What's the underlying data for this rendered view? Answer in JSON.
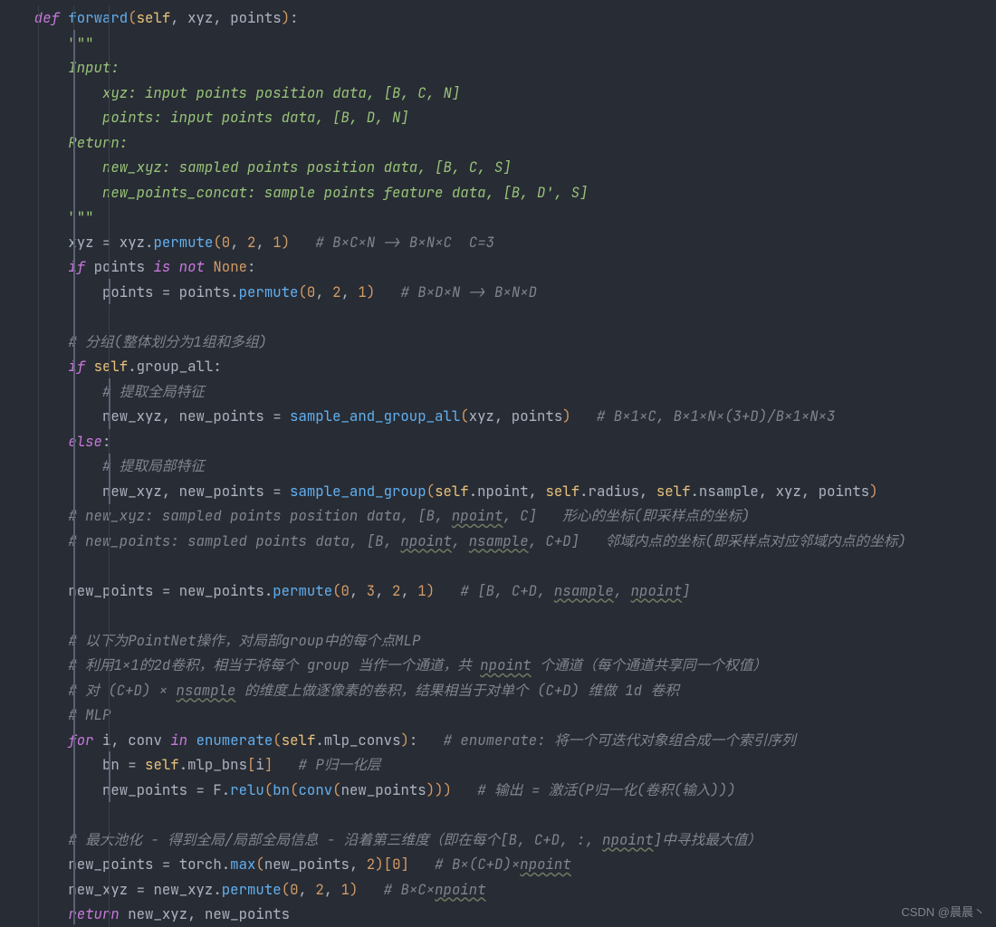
{
  "watermark": "CSDN @晨晨丶",
  "code": {
    "line01": {
      "kw_def": "def",
      "fn": "forward",
      "par_o": "(",
      "self": "self",
      "c1": ", ",
      "a1": "xyz",
      "c2": ", ",
      "a2": "points",
      "par_c": ")",
      "colon": ":"
    },
    "line02": {
      "tdq": "\"\"\""
    },
    "line03": {
      "txt": "Input:"
    },
    "line04": {
      "txt": "    xyz: input points position data, [B, C, N]"
    },
    "line05": {
      "txt": "    points: input points data, [B, D, N]"
    },
    "line06": {
      "txt": "Return:"
    },
    "line07": {
      "txt": "    new_xyz: sampled points position data, [B, C, S]"
    },
    "line08": {
      "txt": "    new_points_concat: sample points feature data, [B, D', S]"
    },
    "line09": {
      "tdq": "\"\"\""
    },
    "line10": {
      "lhs": "xyz ",
      "eq": "= ",
      "rhs_id": "xyz",
      "dot": ".",
      "fn": "permute",
      "po": "(",
      "n0": "0",
      "c1": ", ",
      "n1": "2",
      "c2": ", ",
      "n2": "1",
      "pc": ")",
      "cm": "   # B×C×N -> B×N×C  C=3"
    },
    "line11": {
      "kw_if": "if",
      "sp": " ",
      "id": "points",
      "sp2": " ",
      "kw_is": "is",
      "sp3": " ",
      "kw_not": "not",
      "sp4": " ",
      "none": "None",
      "colon": ":"
    },
    "line12": {
      "lhs": "points ",
      "eq": "= ",
      "rhs_id": "points",
      "dot": ".",
      "fn": "permute",
      "po": "(",
      "n0": "0",
      "c1": ", ",
      "n1": "2",
      "c2": ", ",
      "n2": "1",
      "pc": ")",
      "cm": "   # B×D×N -> B×N×D"
    },
    "line14": {
      "cm": "# 分组(整体划分为1组和多组)"
    },
    "line15": {
      "kw_if": "if",
      "sp": " ",
      "self": "self",
      "dot": ".",
      "attr": "group_all",
      "colon": ":"
    },
    "line16": {
      "cm": "# 提取全局特征"
    },
    "line17": {
      "lhs": "new_xyz, new_points ",
      "eq": "= ",
      "fn": "sample_and_group_all",
      "po": "(",
      "a1": "xyz",
      "c1": ", ",
      "a2": "points",
      "pc": ")",
      "cm": "   # B×1×C, B×1×N×(3+D)/B×1×N×3"
    },
    "line18": {
      "kw_else": "else",
      "colon": ":"
    },
    "line19": {
      "cm": "# 提取局部特征"
    },
    "line20": {
      "lhs": "new_xyz, new_points ",
      "eq": "= ",
      "fn": "sample_and_group",
      "po": "(",
      "self1": "self",
      "d1": ".",
      "a1": "npoint",
      "c1": ", ",
      "self2": "self",
      "d2": ".",
      "a2": "radius",
      "c2": ", ",
      "self3": "self",
      "d3": ".",
      "a3": "nsample",
      "c3": ", ",
      "a4": "xyz",
      "c4": ", ",
      "a5": "points",
      "pc": ")"
    },
    "line21": {
      "pre": "# new_xyz: sampled points position data, [B, ",
      "w": "npoint",
      "post": ", C]   形心的坐标(即采样点的坐标)"
    },
    "line22": {
      "pre": "# new_points: sampled points data, [B, ",
      "w1": "npoint",
      "mid": ", ",
      "w2": "nsample",
      "post": ", C+D]   邻域内点的坐标(即采样点对应邻域内点的坐标)"
    },
    "line24": {
      "lhs": "new_points ",
      "eq": "= ",
      "rhs_id": "new_points",
      "dot": ".",
      "fn": "permute",
      "po": "(",
      "n0": "0",
      "c1": ", ",
      "n1": "3",
      "c2": ", ",
      "n2": "2",
      "c3": ", ",
      "n3": "1",
      "pc": ")",
      "cm_pre": "   # [B, C+D, ",
      "w1": "nsample",
      "cm_mid": ", ",
      "w2": "npoint",
      "cm_post": "]"
    },
    "line26": {
      "cm": "# 以下为PointNet操作，对局部group中的每个点MLP"
    },
    "line27": {
      "pre": "# 利用1×1的2d卷积，相当于将每个 group 当作一个通道，共 ",
      "w": "npoint",
      "post": " 个通道（每个通道共享同一个权值）"
    },
    "line28": {
      "pre": "# 对 (C+D) × ",
      "w": "nsample",
      "post": " 的维度上做逐像素的卷积，结果相当于对单个 (C+D) 维做 1d 卷积"
    },
    "line29": {
      "cm": "# MLP"
    },
    "line30": {
      "kw_for": "for",
      "sp": " ",
      "v1": "i",
      "c1": ", ",
      "v2": "conv",
      "sp2": " ",
      "kw_in": "in",
      "sp3": " ",
      "fn": "enumerate",
      "po": "(",
      "self": "self",
      "dot": ".",
      "attr": "mlp_convs",
      "pc": ")",
      "colon": ":",
      "cm": "   # enumerate: 将一个可迭代对象组合成一个索引序列"
    },
    "line31": {
      "lhs": "bn ",
      "eq": "= ",
      "self": "self",
      "dot": ".",
      "attr": "mlp_bns",
      "bo": "[",
      "idx": "i",
      "bc": "]",
      "cm": "   # P归一化层"
    },
    "line32": {
      "lhs": "new_points ",
      "eq": "= ",
      "F": "F",
      "dot": ".",
      "fn": "relu",
      "po": "(",
      "bn": "bn",
      "po2": "(",
      "conv": "conv",
      "po3": "(",
      "arg": "new_points",
      "pc3": ")",
      "pc2": ")",
      "pc": ")",
      "cm": "   # 输出 = 激活(P归一化(卷积(输入)))"
    },
    "line34": {
      "pre": "# 最大池化 - 得到全局/局部全局信息 - 沿着第三维度（即在每个[B, C+D, :, ",
      "w": "npoint",
      "post": "]中寻找最大值）"
    },
    "line35": {
      "lhs": "new_points ",
      "eq": "= ",
      "mod": "torch",
      "dot": ".",
      "fn": "max",
      "po": "(",
      "a1": "new_points",
      "c1": ", ",
      "n": "2",
      "pc": ")",
      "bo": "[",
      "n0": "0",
      "bc": "]",
      "cm_pre": "   # B×(C+D)×",
      "w": "npoint"
    },
    "line36": {
      "lhs": "new_xyz ",
      "eq": "= ",
      "rhs_id": "new_xyz",
      "dot": ".",
      "fn": "permute",
      "po": "(",
      "n0": "0",
      "c1": ", ",
      "n1": "2",
      "c2": ", ",
      "n2": "1",
      "pc": ")",
      "cm_pre": "   # B×C×",
      "w": "npoint"
    },
    "line37": {
      "kw": "return",
      "sp": " ",
      "r1": "new_xyz",
      "c": ", ",
      "r2": "new_points"
    }
  }
}
